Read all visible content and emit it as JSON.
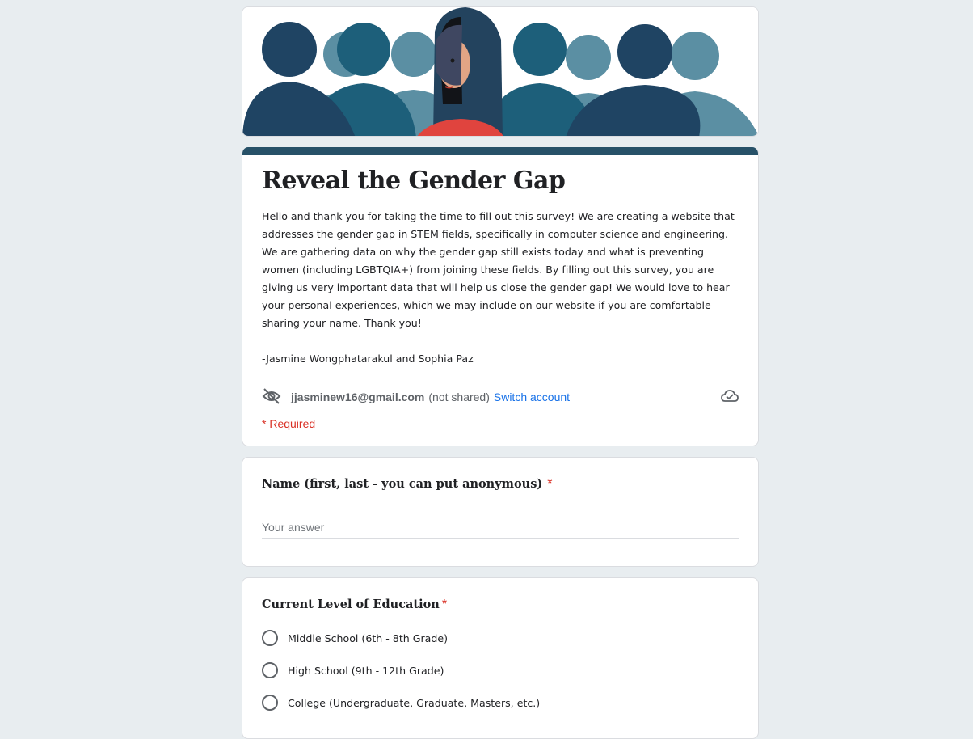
{
  "form": {
    "title": "Reveal the Gender Gap",
    "description": "Hello and thank you for taking the time to fill out this survey! We are creating a website that addresses the gender gap in STEM fields, specifically in computer science and engineering. We are gathering data on why the gender gap still exists today and what is preventing women (including LGBTQIA+) from joining these fields. By filling out this survey, you are giving us very important data that will help us close the gender gap! We would love to hear your personal experiences, which we may include on our website if you are comfortable sharing your name. Thank you!\n\n-Jasmine Wongphatarakul and Sophia Paz",
    "accent_color": "#275168"
  },
  "account": {
    "email": "jjasminew16@gmail.com",
    "not_shared": "(not shared)",
    "switch_label": "Switch account",
    "hidden_icon": "eye-off-icon",
    "cloud_icon": "cloud-check-icon"
  },
  "required_note": "* Required",
  "questions": [
    {
      "title": "Name (first, last - you can put anonymous)",
      "required_mark": "*",
      "placeholder": "Your answer"
    },
    {
      "title": "Current Level of Education",
      "required_mark": "*",
      "options": [
        "Middle School (6th - 8th Grade)",
        "High School (9th - 12th Grade)",
        "College (Undergraduate, Graduate, Masters, etc.)"
      ]
    }
  ]
}
